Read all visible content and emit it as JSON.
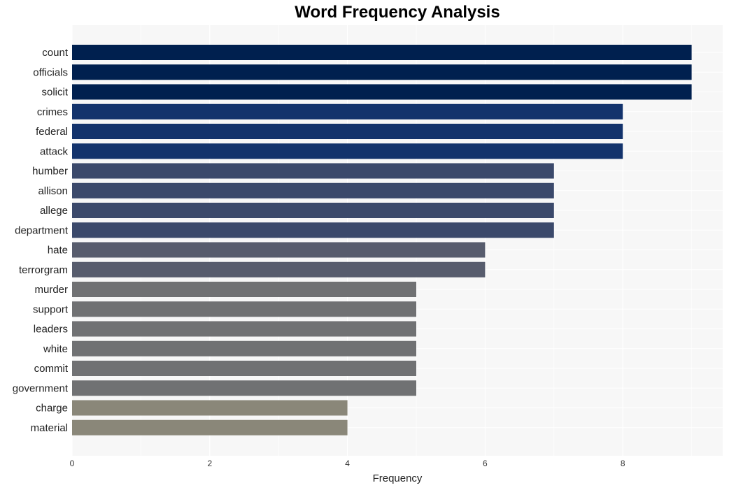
{
  "chart_data": {
    "type": "bar",
    "orientation": "horizontal",
    "title": "Word Frequency Analysis",
    "xlabel": "Frequency",
    "ylabel": "",
    "xlim": [
      0,
      9.45
    ],
    "xticks": [
      0,
      2,
      4,
      6,
      8
    ],
    "grid": true,
    "legend": "none",
    "categories": [
      "count",
      "officials",
      "solicit",
      "crimes",
      "federal",
      "attack",
      "humber",
      "allison",
      "allege",
      "department",
      "hate",
      "terrorgram",
      "murder",
      "support",
      "leaders",
      "white",
      "commit",
      "government",
      "charge",
      "material"
    ],
    "values": [
      9,
      9,
      9,
      8,
      8,
      8,
      7,
      7,
      7,
      7,
      6,
      6,
      5,
      5,
      5,
      5,
      5,
      5,
      4,
      4
    ],
    "colors_by_value": {
      "9": "#00204f",
      "8": "#13336c",
      "7": "#3b496b",
      "6": "#575c6d",
      "5": "#707173",
      "4": "#8a8779"
    },
    "panel_background": "#f7f7f7",
    "grid_color": "#ffffff"
  }
}
